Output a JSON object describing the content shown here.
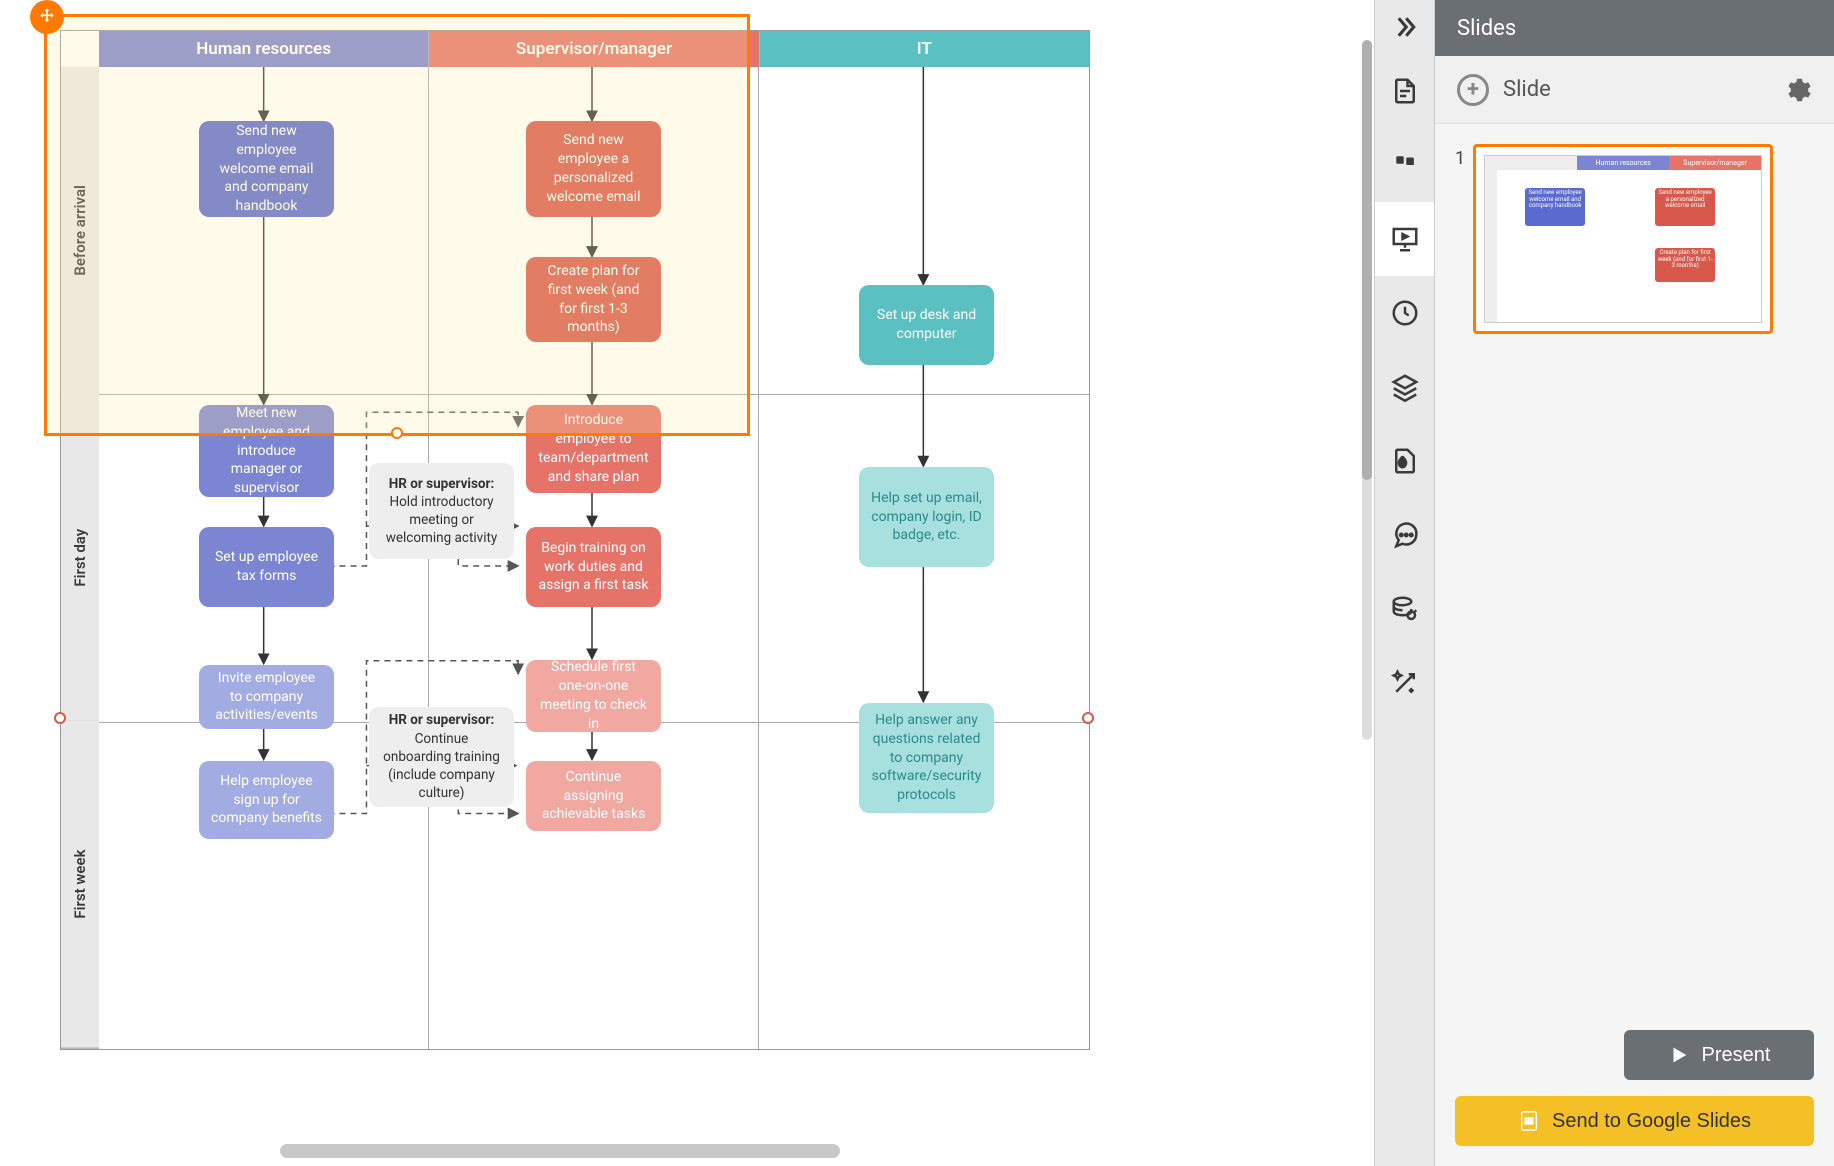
{
  "panel": {
    "title": "Slides",
    "add_label": "Slide",
    "slide_number": "1",
    "present_label": "Present",
    "google_label": "Send to Google Slides"
  },
  "lanes": {
    "hr": "Human resources",
    "sup": "Supervisor/manager",
    "it": "IT"
  },
  "rows": {
    "before": "Before arrival",
    "first_day": "First day",
    "first_week": "First week"
  },
  "nodes": {
    "hr_welcome": "Send new employee welcome email and company handbook",
    "sup_welcome": "Send new employee a personalized welcome email",
    "sup_plan": "Create plan for first week (and for first 1-3 months)",
    "it_desk": "Set up desk and computer",
    "hr_meet": "Meet new employee and introduce manager or supervisor",
    "hr_tax": "Set up employee tax forms",
    "neutral1_bold": "HR or supervisor:",
    "neutral1_rest": "Hold introductory meeting or welcoming activity",
    "sup_intro": "Introduce employee to team/department and share plan",
    "sup_train": "Begin training on work duties and assign a first task",
    "it_email": "Help set up email, company login, ID badge, etc.",
    "hr_invite": "Invite employee to company activities/events",
    "hr_benefits": "Help employee sign up for company benefits",
    "neutral2_bold": "HR or supervisor:",
    "neutral2_rest": "Continue onboarding training (include company culture)",
    "sup_oneone": "Schedule first one-on-one meeting to check in",
    "sup_assign": "Continue assigning achievable tasks",
    "it_questions": "Help answer any questions related to company software/security protocols"
  }
}
